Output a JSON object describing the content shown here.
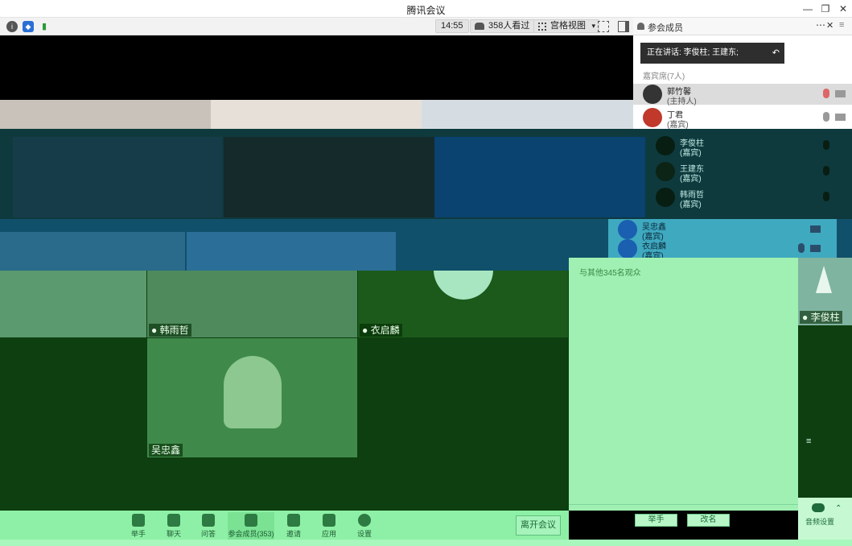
{
  "window": {
    "title": "腾讯会议"
  },
  "toolbar": {
    "time": "14:55",
    "viewers": "358人看过",
    "layout": "宫格视图"
  },
  "sidebar": {
    "title": "参会成员",
    "speaking": "正在讲话: 李俊柱; 王建东;",
    "section": "嘉宾席(7人)",
    "members": [
      {
        "name": "郭竹馨",
        "role": "(主持人)"
      },
      {
        "name": "丁君",
        "role": "(嘉宾)"
      },
      {
        "name": "李俊柱",
        "role": "(嘉宾)"
      },
      {
        "name": "王建东",
        "role": "(嘉宾)"
      },
      {
        "name": "韩雨哲",
        "role": "(嘉宾)"
      },
      {
        "name": "吴忠鑫",
        "role": "(嘉宾)"
      },
      {
        "name": "衣启麟",
        "role": "(嘉宾)"
      }
    ],
    "others": "与其他345名观众",
    "raise_hand": "举手",
    "rename": "改名"
  },
  "tiles": [
    {
      "name": "韩雨哲"
    },
    {
      "name": "衣启麟"
    },
    {
      "name": "吴忠鑫"
    },
    {
      "name": "李俊柱"
    }
  ],
  "bottombar": {
    "items": [
      {
        "label": "举手"
      },
      {
        "label": "聊天"
      },
      {
        "label": "问答"
      },
      {
        "label": "参会成员(353)"
      },
      {
        "label": "邀请"
      },
      {
        "label": "应用"
      },
      {
        "label": "设置"
      }
    ],
    "leave": "离开会议",
    "audio_settings": "音频设置"
  },
  "colors": {
    "green_overlay": "#0e3f10",
    "panel_green": "#9ff0b2",
    "toolbar_green": "#8ef0a6",
    "teal": "#0e3a3e"
  }
}
